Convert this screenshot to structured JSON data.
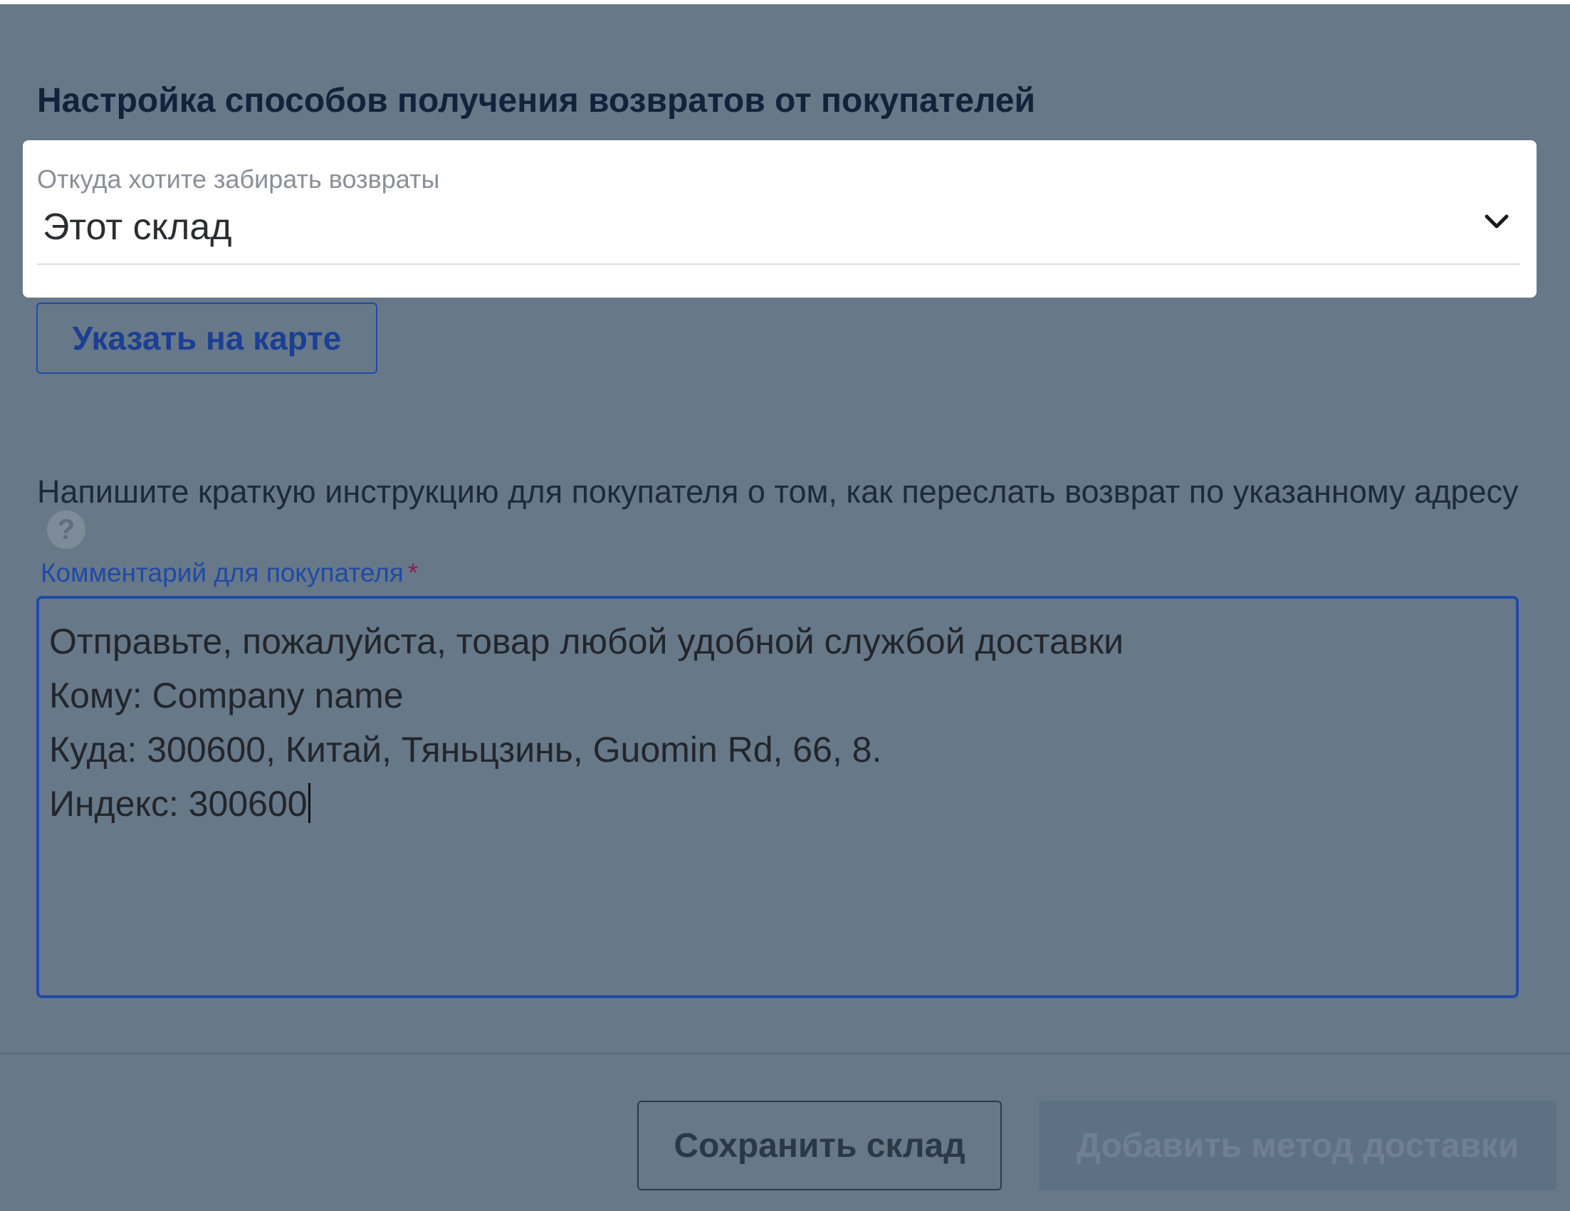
{
  "section": {
    "title": "Настройка способов получения возвратов от покупателей"
  },
  "returns_source": {
    "label": "Откуда хотите забирать возвраты",
    "value": "Этот склад",
    "icon": "chevron-down-icon"
  },
  "map_button": {
    "label": "Указать на карте"
  },
  "instruction": {
    "text": "Напишите краткую инструкцию для покупателя о том, как переслать возврат по указанному адресу",
    "help_icon": "?"
  },
  "comment": {
    "label": "Комментарий для покупателя",
    "required_mark": "*",
    "lines": [
      "Отправьте, пожалуйста, товар любой удобной службой доставки",
      "Кому: Company name",
      "Куда: 300600, Китай, Тяньцзинь, Guomin Rd, 66, 8.",
      "Индекс: 300600"
    ]
  },
  "footer": {
    "save_label": "Сохранить склад",
    "add_method_label": "Добавить метод доставки"
  },
  "colors": {
    "overlay": "#677888",
    "accent": "#1f4aa6",
    "title": "#14213a",
    "required": "#8b1e5a"
  }
}
